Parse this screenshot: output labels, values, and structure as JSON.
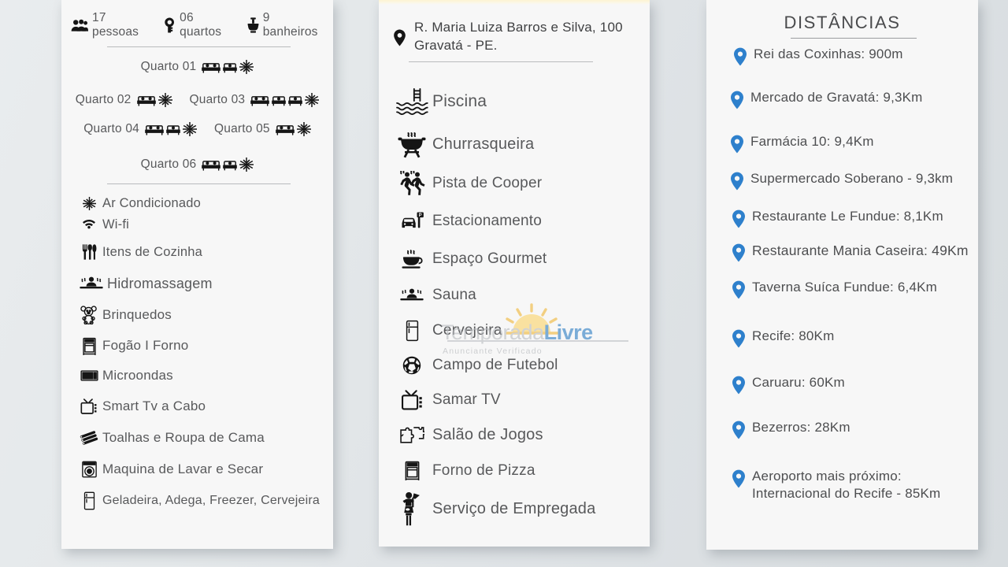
{
  "background": {
    "color": "#e4e8ea"
  },
  "cards": {
    "amenities": {
      "summary": [
        {
          "icon": "people-icon",
          "label": "17 pessoas"
        },
        {
          "icon": "key-icon",
          "label": "06 quartos"
        },
        {
          "icon": "toilet-icon",
          "label": "9 banheiros"
        }
      ],
      "rooms": [
        {
          "label": "Quarto 01",
          "icons": [
            "double-bed-icon",
            "single-bed-icon",
            "snowflake-icon"
          ]
        },
        {
          "label": "Quarto 02",
          "icons": [
            "double-bed-icon",
            "snowflake-icon"
          ]
        },
        {
          "label": "Quarto 03",
          "icons": [
            "double-bed-icon",
            "single-bed-icon",
            "single-bed-icon",
            "snowflake-icon"
          ]
        },
        {
          "label": "Quarto 04",
          "icons": [
            "double-bed-icon",
            "single-bed-icon",
            "snowflake-icon"
          ]
        },
        {
          "label": "Quarto 05",
          "icons": [
            "double-bed-icon",
            "snowflake-icon"
          ]
        },
        {
          "label": "Quarto 06",
          "icons": [
            "double-bed-icon",
            "single-bed-icon",
            "snowflake-icon"
          ]
        }
      ],
      "items": [
        {
          "icon": "snowflake-icon",
          "label": "Ar Condicionado"
        },
        {
          "icon": "wifi-icon",
          "label": "Wi-fi"
        },
        {
          "icon": "cutlery-icon",
          "label": "Itens de Cozinha"
        },
        {
          "icon": "jacuzzi-icon",
          "label": "Hidromassagem"
        },
        {
          "icon": "teddy-bear-icon",
          "label": "Brinquedos"
        },
        {
          "icon": "stove-icon",
          "label": "Fogão I Forno"
        },
        {
          "icon": "microwave-icon",
          "label": "Microondas"
        },
        {
          "icon": "tv-icon",
          "label": "Smart Tv a Cabo"
        },
        {
          "icon": "towels-icon",
          "label": "Toalhas e Roupa de Cama"
        },
        {
          "icon": "washer-icon",
          "label": "Maquina de Lavar e Secar"
        },
        {
          "icon": "fridge-icon",
          "label": "Geladeira, Adega, Freezer, Cervejeira"
        }
      ]
    },
    "features": {
      "address": {
        "icon": "map-pin-icon",
        "line1": "R. Maria Luiza Barros e Silva, 100",
        "line2": "Gravatá - PE."
      },
      "items": [
        {
          "icon": "pool-icon",
          "label": "Piscina"
        },
        {
          "icon": "grill-icon",
          "label": "Churrasqueira"
        },
        {
          "icon": "runners-icon",
          "label": "Pista de Cooper"
        },
        {
          "icon": "parking-icon",
          "label": "Estacionamento"
        },
        {
          "icon": "coffee-cup-icon",
          "label": "Espaço Gourmet"
        },
        {
          "icon": "sauna-icon",
          "label": "Sauna"
        },
        {
          "icon": "fridge-icon",
          "label": "Cervejeira"
        },
        {
          "icon": "soccer-ball-icon",
          "label": "Campo de Futebol"
        },
        {
          "icon": "tv-icon",
          "label": "Samar TV"
        },
        {
          "icon": "puzzle-icon",
          "label": "Salão de Jogos"
        },
        {
          "icon": "oven-icon",
          "label": "Forno de Pizza"
        },
        {
          "icon": "maid-icon",
          "label": "Serviço de Empregada"
        }
      ]
    },
    "distances": {
      "title": "DISTÂNCIAS",
      "pin_color": "#2e80cc",
      "items": [
        {
          "icon": "map-pin-icon",
          "label": "Rei das Coxinhas: 900m"
        },
        {
          "icon": "map-pin-icon",
          "label": "Mercado de Gravatá: 9,3Km"
        },
        {
          "icon": "map-pin-icon",
          "label": "Farmácia 10: 9,4Km"
        },
        {
          "icon": "map-pin-icon",
          "label": "Supermercado Soberano - 9,3km"
        },
        {
          "icon": "map-pin-icon",
          "label": "Restaurante Le Fundue: 8,1Km"
        },
        {
          "icon": "map-pin-icon",
          "label": "Restaurante Mania Caseira: 49Km"
        },
        {
          "icon": "map-pin-icon",
          "label": "Taverna Suíca Fundue: 6,4Km"
        },
        {
          "icon": "map-pin-icon",
          "label": "Recife: 80Km"
        },
        {
          "icon": "map-pin-icon",
          "label": "Caruaru: 60Km"
        },
        {
          "icon": "map-pin-icon",
          "label": "Bezerros: 28Km"
        },
        {
          "icon": "map-pin-icon",
          "label": "Aeroporto mais próximo:\nInternacional do Recife - 85Km"
        }
      ]
    }
  },
  "watermark": {
    "part_a": "Temporada",
    "part_b": "Livre",
    "subtitle": "Anunciante Verificado",
    "color_a": "#b9bcc0",
    "color_b": "#2f7fc4"
  }
}
